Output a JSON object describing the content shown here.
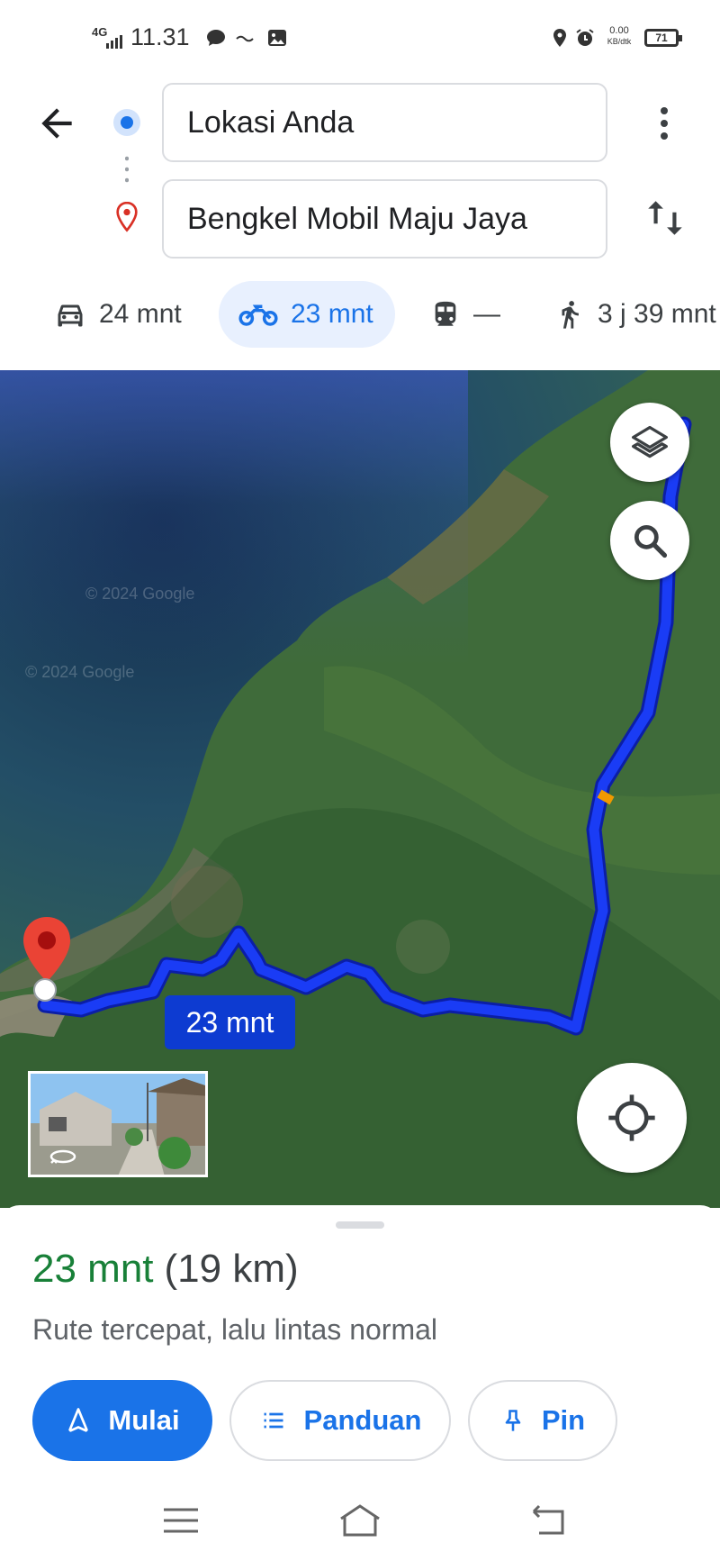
{
  "status_bar": {
    "network": "4G",
    "time": "11.31",
    "speed_value": "0.00",
    "speed_unit": "KB/dtk",
    "battery": "71"
  },
  "directions": {
    "origin": "Lokasi Anda",
    "destination": "Bengkel Mobil Maju Jaya"
  },
  "modes": [
    {
      "icon": "car-icon",
      "label": "24 mnt",
      "active": false
    },
    {
      "icon": "motorcycle-icon",
      "label": "23 mnt",
      "active": true
    },
    {
      "icon": "transit-icon",
      "label": "—",
      "active": false
    },
    {
      "icon": "walk-icon",
      "label": "3 j 39 mnt",
      "active": false
    }
  ],
  "map": {
    "route_label": "23 mnt",
    "watermark": "© 2024 Google",
    "route_color": "#1a3cf5"
  },
  "summary": {
    "duration": "23 mnt",
    "distance": "(19 km)",
    "description": "Rute tercepat, lalu lintas normal"
  },
  "actions": {
    "start": "Mulai",
    "guide": "Panduan",
    "pin": "Pin"
  },
  "colors": {
    "accent": "#1a73e8",
    "eta_green": "#188038"
  }
}
